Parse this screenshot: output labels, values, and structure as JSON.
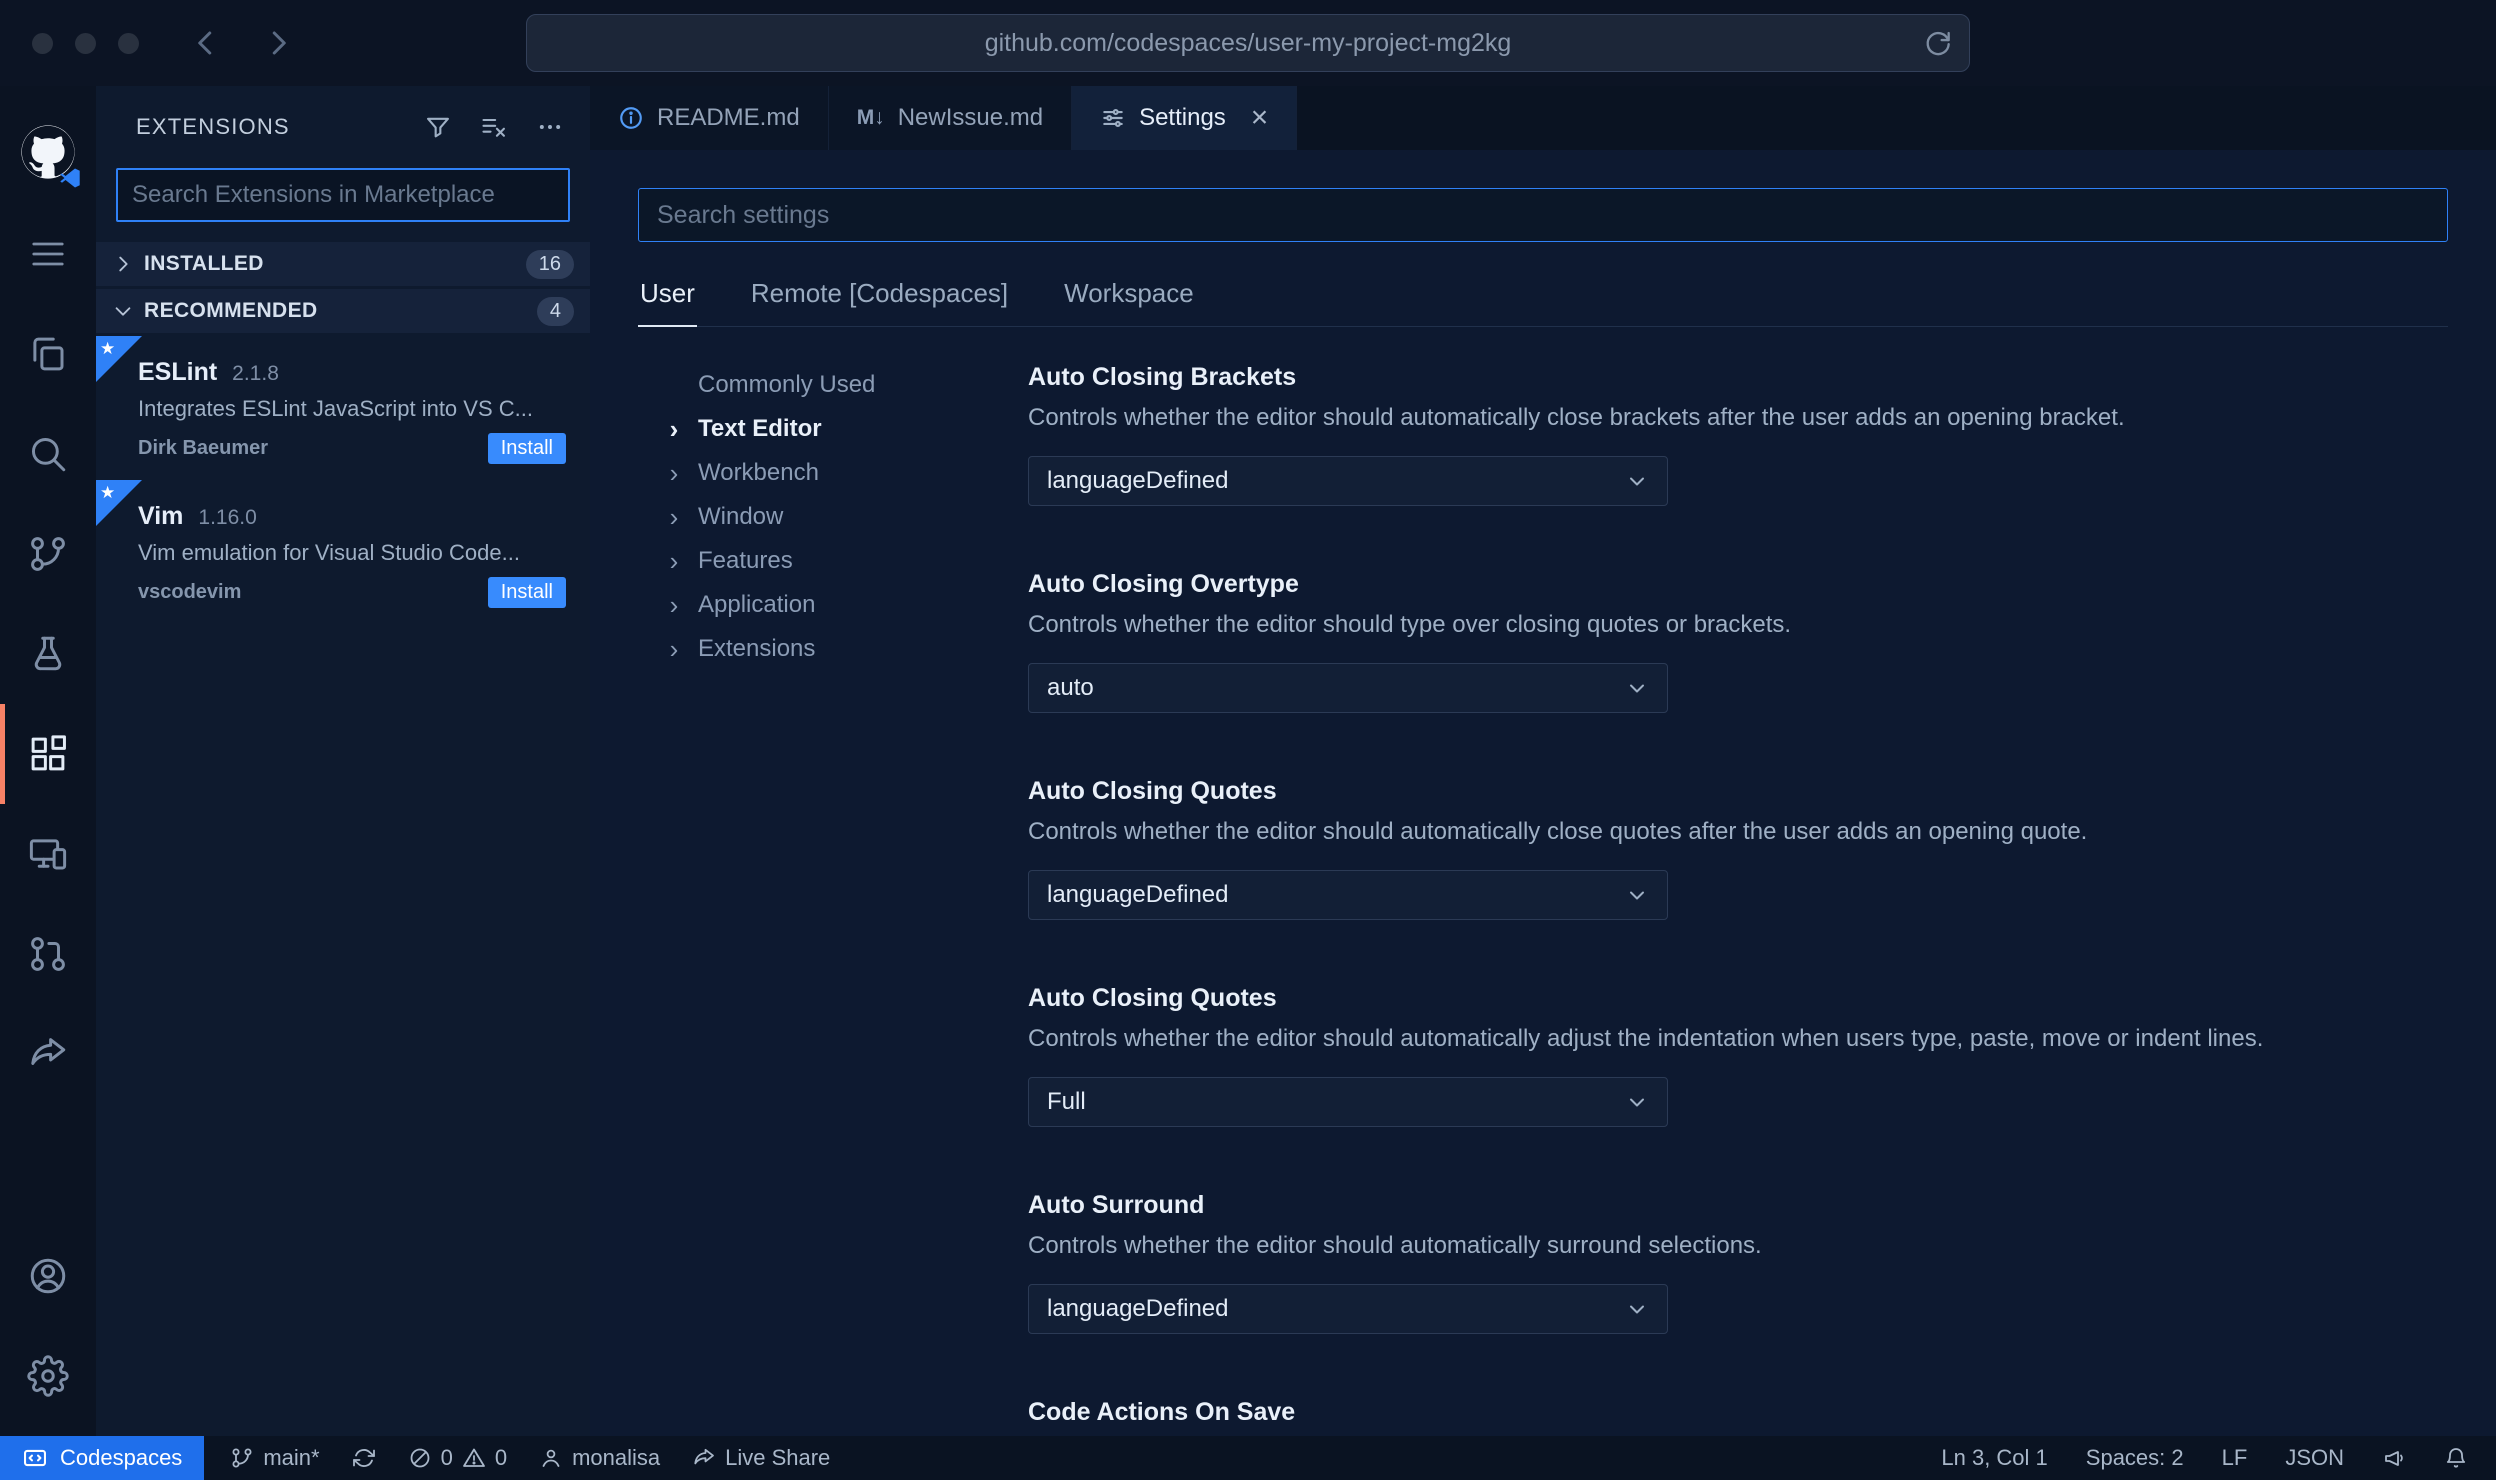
{
  "browser": {
    "url": "github.com/codespaces/user-my-project-mg2kg"
  },
  "activity_bar": {
    "icons": [
      "github-logo",
      "menu",
      "explorer",
      "search",
      "source-control",
      "testing",
      "extensions",
      "remote-explorer",
      "pull-requests",
      "live-share",
      "account",
      "settings"
    ]
  },
  "sidebar": {
    "title": "EXTENSIONS",
    "search_placeholder": "Search Extensions in Marketplace",
    "sections": [
      {
        "label": "INSTALLED",
        "count": "16"
      },
      {
        "label": "RECOMMENDED",
        "count": "4"
      }
    ],
    "extensions": [
      {
        "name": "ESLint",
        "version": "2.1.8",
        "description": "Integrates ESLint JavaScript into VS C...",
        "publisher": "Dirk Baeumer",
        "action": "Install"
      },
      {
        "name": "Vim",
        "version": "1.16.0",
        "description": "Vim emulation for Visual Studio Code...",
        "publisher": "vscodevim",
        "action": "Install"
      }
    ]
  },
  "editor": {
    "tabs": [
      {
        "label": "README.md"
      },
      {
        "label": "NewIssue.md",
        "icon_glyph": "M↓"
      },
      {
        "label": "Settings",
        "close": "×"
      }
    ]
  },
  "settings": {
    "search_placeholder": "Search settings",
    "scopes": [
      {
        "label": "User"
      },
      {
        "label": "Remote [Codespaces]"
      },
      {
        "label": "Workspace"
      }
    ],
    "toc": [
      {
        "label": "Commonly Used"
      },
      {
        "label": "Text Editor"
      },
      {
        "label": "Workbench"
      },
      {
        "label": "Window"
      },
      {
        "label": "Features"
      },
      {
        "label": "Application"
      },
      {
        "label": "Extensions"
      }
    ],
    "items": [
      {
        "title": "Auto Closing Brackets",
        "description": "Controls whether the editor should automatically close brackets after the user adds an opening bracket.",
        "value": "languageDefined"
      },
      {
        "title": "Auto Closing Overtype",
        "description": "Controls whether the editor should type over closing quotes or brackets.",
        "value": "auto"
      },
      {
        "title": "Auto Closing Quotes",
        "description": "Controls whether the editor should automatically close quotes after the user adds an opening quote.",
        "value": "languageDefined"
      },
      {
        "title": "Auto Closing Quotes",
        "description": "Controls whether the editor should automatically adjust the indentation when users type, paste, move or indent lines.",
        "value": "Full"
      },
      {
        "title": "Auto Surround",
        "description": "Controls whether the editor should automatically surround selections.",
        "value": "languageDefined"
      },
      {
        "title": "Code Actions On Save",
        "description": "",
        "value": ""
      }
    ]
  },
  "status_bar": {
    "codespaces": "Codespaces",
    "branch": "main*",
    "errors": "0",
    "warnings": "0",
    "user": "monalisa",
    "live_share": "Live Share",
    "cursor": "Ln 3, Col 1",
    "indent": "Spaces: 2",
    "eol": "LF",
    "language": "JSON"
  },
  "colors": {
    "accent": "#2f81f7",
    "install_button": "#388bfd",
    "codespaces_bg": "#1f6feb",
    "active_indicator": "#f78166",
    "badge_bg": "#2e3d59"
  }
}
